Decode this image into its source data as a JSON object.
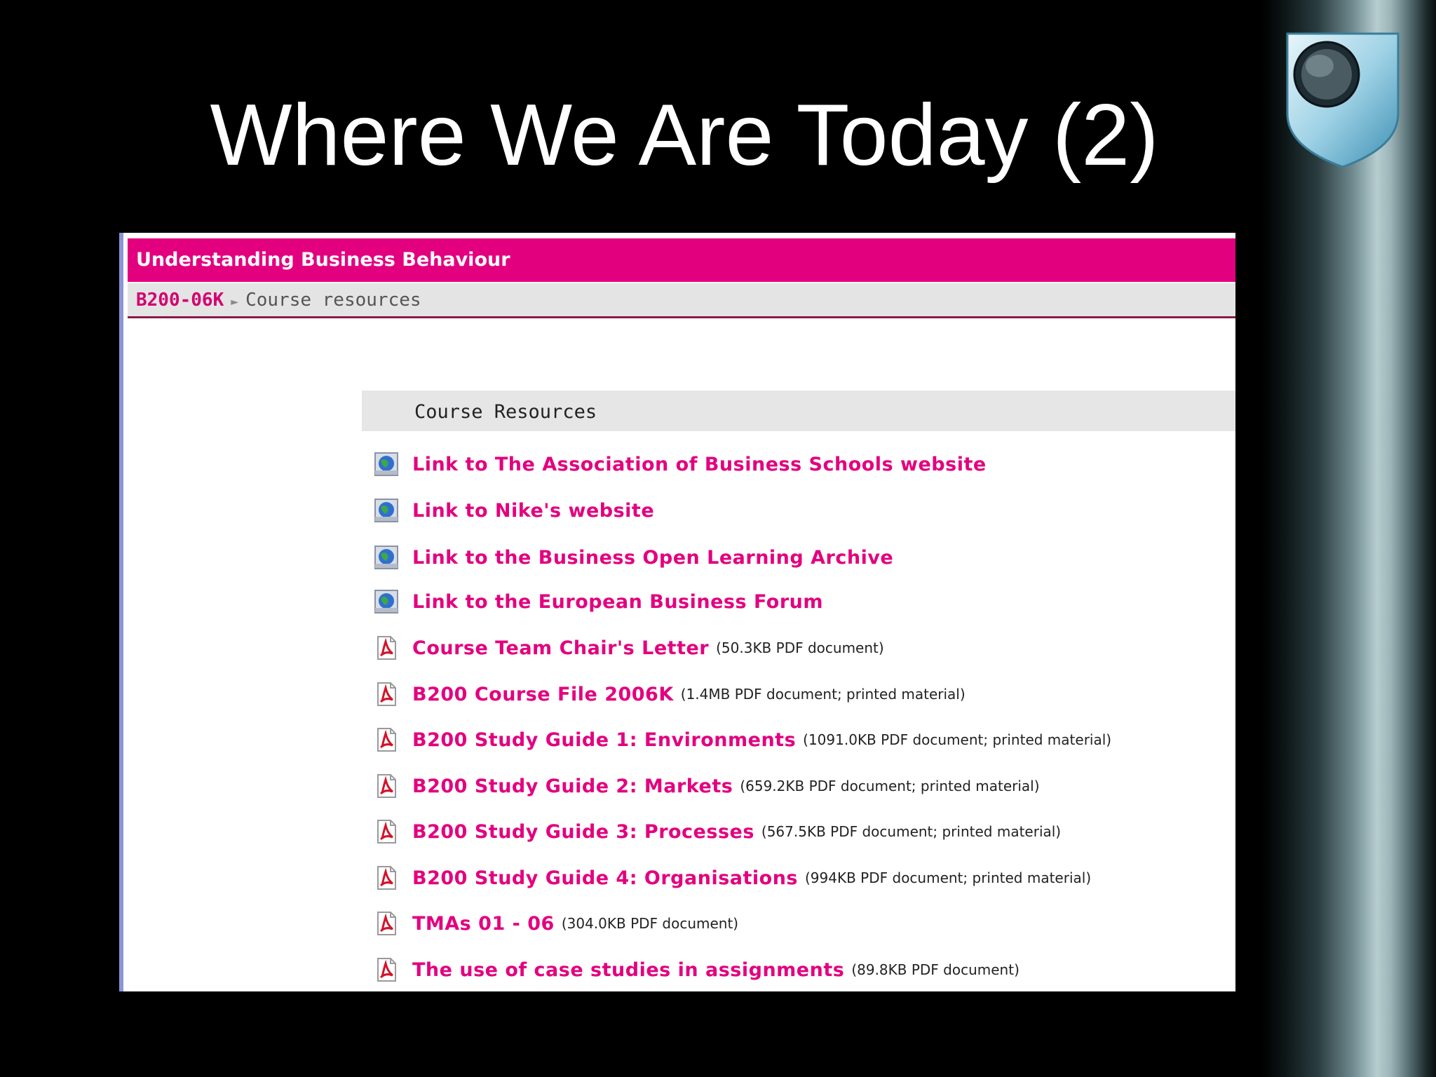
{
  "slide": {
    "title": "Where We Are Today (2)"
  },
  "screenshot": {
    "header_title": "Understanding Business Behaviour",
    "breadcrumb": {
      "course": "B200-06K",
      "current": "Course resources"
    },
    "section_title": "Course Resources",
    "resources": [
      {
        "icon": "web-link-icon",
        "label": "Link to The Association of Business Schools website",
        "meta": ""
      },
      {
        "icon": "web-link-icon",
        "label": "Link to Nike's website",
        "meta": ""
      },
      {
        "icon": "web-link-icon",
        "label": "Link to the Business Open Learning Archive",
        "meta": ""
      },
      {
        "icon": "web-link-icon",
        "label": "Link to the European Business Forum",
        "meta": ""
      },
      {
        "icon": "pdf-icon",
        "label": "Course Team Chair's Letter",
        "meta": "(50.3KB PDF document)"
      },
      {
        "icon": "pdf-icon",
        "label": "B200 Course File 2006K",
        "meta": "(1.4MB PDF document; printed material)"
      },
      {
        "icon": "pdf-icon",
        "label": "B200 Study Guide 1: Environments",
        "meta": "(1091.0KB PDF document; printed material)"
      },
      {
        "icon": "pdf-icon",
        "label": "B200 Study Guide 2: Markets",
        "meta": "(659.2KB PDF document; printed material)"
      },
      {
        "icon": "pdf-icon",
        "label": "B200 Study Guide 3: Processes",
        "meta": "(567.5KB PDF document; printed material)"
      },
      {
        "icon": "pdf-icon",
        "label": "B200 Study Guide 4: Organisations",
        "meta": "(994KB PDF document; printed material)"
      },
      {
        "icon": "pdf-icon",
        "label": "TMAs 01 - 06",
        "meta": "(304.0KB PDF document)"
      },
      {
        "icon": "pdf-icon",
        "label": "The use of case studies in assignments",
        "meta": "(89.8KB PDF document)"
      }
    ]
  },
  "colors": {
    "brand_magenta": "#e3007f",
    "background": "#000000",
    "breadcrumb_bg": "#e4e4e4"
  }
}
